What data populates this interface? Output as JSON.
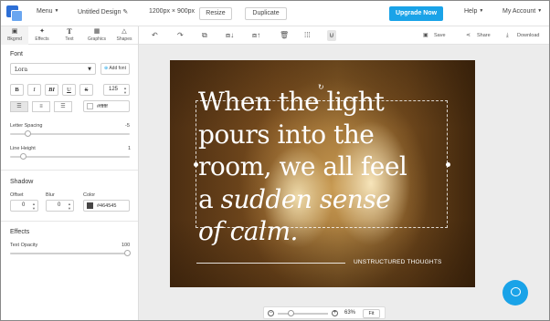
{
  "topbar": {
    "menu_label": "Menu",
    "design_title": "Untitled Design",
    "dimensions": "1200px × 900px",
    "resize_label": "Resize",
    "duplicate_label": "Duplicate",
    "upgrade_label": "Upgrade Now",
    "help_label": "Help",
    "account_label": "My Account"
  },
  "tabs": [
    {
      "label": "Bkgrnd",
      "icon": "background-icon"
    },
    {
      "label": "Effects",
      "icon": "effects-icon"
    },
    {
      "label": "Text",
      "icon": "text-icon"
    },
    {
      "label": "Graphics",
      "icon": "graphics-icon"
    },
    {
      "label": "Shapes",
      "icon": "shapes-icon"
    }
  ],
  "font_panel": {
    "section_title": "Font",
    "font_name": "Lora",
    "add_font_label": "Add font",
    "format_buttons": [
      "B",
      "I",
      "BI",
      "U",
      "S"
    ],
    "font_size": "125",
    "color_value": "#ffffff",
    "letter_spacing_label": "Letter Spacing",
    "letter_spacing_value": "-5",
    "line_height_label": "Line Height",
    "line_height_value": "1"
  },
  "shadow_panel": {
    "section_title": "Shadow",
    "offset_label": "Offset",
    "offset_value": "0",
    "blur_label": "Blur",
    "blur_value": "0",
    "color_label": "Color",
    "color_value": "#464545"
  },
  "effects_panel": {
    "section_title": "Effects",
    "opacity_label": "Text Opacity",
    "opacity_value": "100"
  },
  "toolbar": {
    "save_label": "Save",
    "share_label": "Share",
    "download_label": "Download"
  },
  "canvas": {
    "quote_lines": [
      "When the light",
      "pours into the",
      "room, we all feel"
    ],
    "quote_line4_plain": "a ",
    "quote_line4_italic": "sudden sense",
    "quote_line5_italic": "of calm.",
    "brand_text": "UNSTRUCTURED THOUGHTS"
  },
  "zoom": {
    "percent": "63%",
    "fit_label": "Fit",
    "level_fraction": 0.63
  },
  "colors": {
    "accent": "#1aa3e8",
    "text_color": "#ffffff",
    "shadow_color": "#464545"
  }
}
